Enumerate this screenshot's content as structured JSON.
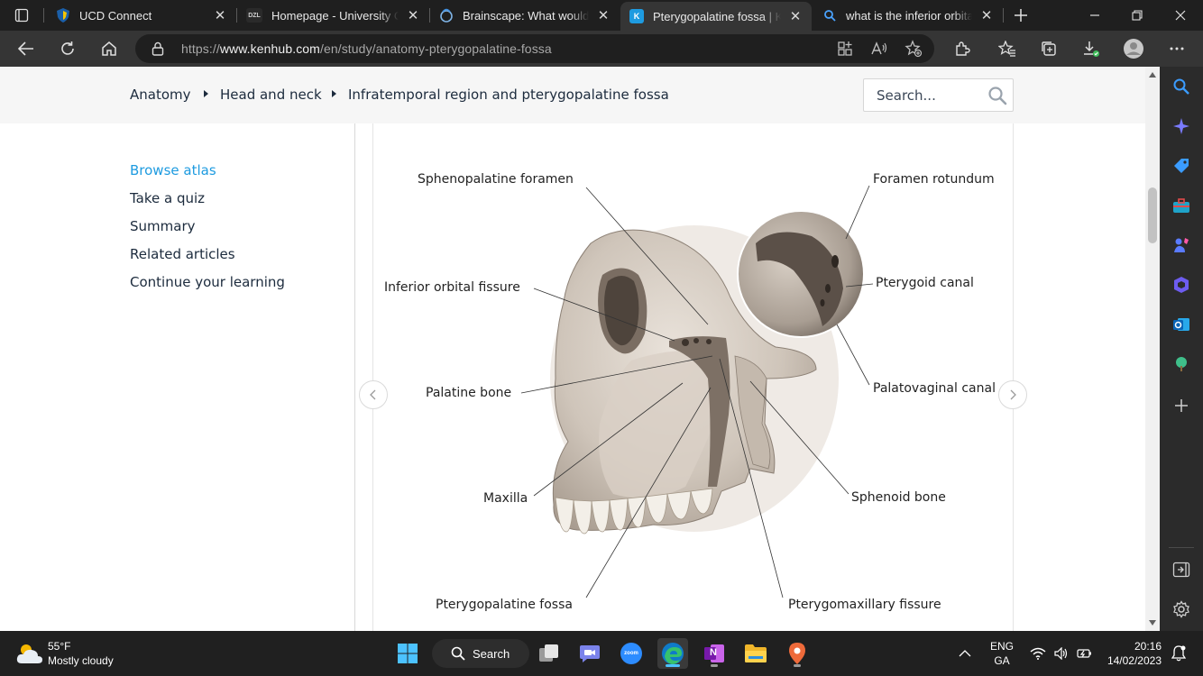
{
  "browser": {
    "tabs": [
      {
        "title": "UCD Connect",
        "favicon": "shield-icon"
      },
      {
        "title": "Homepage - University College Dublin",
        "favicon": "dzl-icon"
      },
      {
        "title": "Brainscape: What would you like to study",
        "favicon": "brainscape-icon"
      },
      {
        "title": "Pterygopalatine fossa | Kenhub",
        "favicon": "kenhub-icon",
        "active": true
      },
      {
        "title": "what is the inferior orbital fissure",
        "favicon": "search-icon"
      }
    ],
    "favicon_text": {
      "dzl": "DZL",
      "kenhub": "K"
    },
    "url_prefix": "https://",
    "url_host": "www.kenhub.com",
    "url_path": "/en/study/anatomy-pterygopalatine-fossa"
  },
  "page": {
    "breadcrumbs": [
      "Anatomy",
      "Head and neck",
      "Infratemporal region and pterygopalatine fossa"
    ],
    "search_placeholder": "Search...",
    "sidenav": [
      {
        "label": "Browse atlas",
        "active": true
      },
      {
        "label": "Take a quiz"
      },
      {
        "label": "Summary"
      },
      {
        "label": "Related articles"
      },
      {
        "label": "Continue your learning"
      }
    ],
    "labels": {
      "sphenopalatine_foramen": "Sphenopalatine foramen",
      "foramen_rotundum": "Foramen rotundum",
      "inferior_orbital_fissure": "Inferior orbital fissure",
      "pterygoid_canal": "Pterygoid canal",
      "palatine_bone": "Palatine bone",
      "palatovaginal_canal": "Palatovaginal canal",
      "maxilla": "Maxilla",
      "sphenoid_bone": "Sphenoid bone",
      "pterygopalatine_fossa": "Pterygopalatine fossa",
      "pterygomaxillary_fissure": "Pterygomaxillary fissure"
    }
  },
  "taskbar": {
    "weather_temp": "55°F",
    "weather_condition": "Mostly cloudy",
    "search_label": "Search",
    "zoom_label": "zoom",
    "onenote_letter": "N",
    "lang_top": "ENG",
    "lang_bottom": "GA",
    "time": "20:16",
    "date": "14/02/2023"
  },
  "colors": {
    "accent": "#1e9be0",
    "tab_bg": "#1f1f1f",
    "toolbar_bg": "#353535",
    "taskbar_bg": "#202020"
  }
}
